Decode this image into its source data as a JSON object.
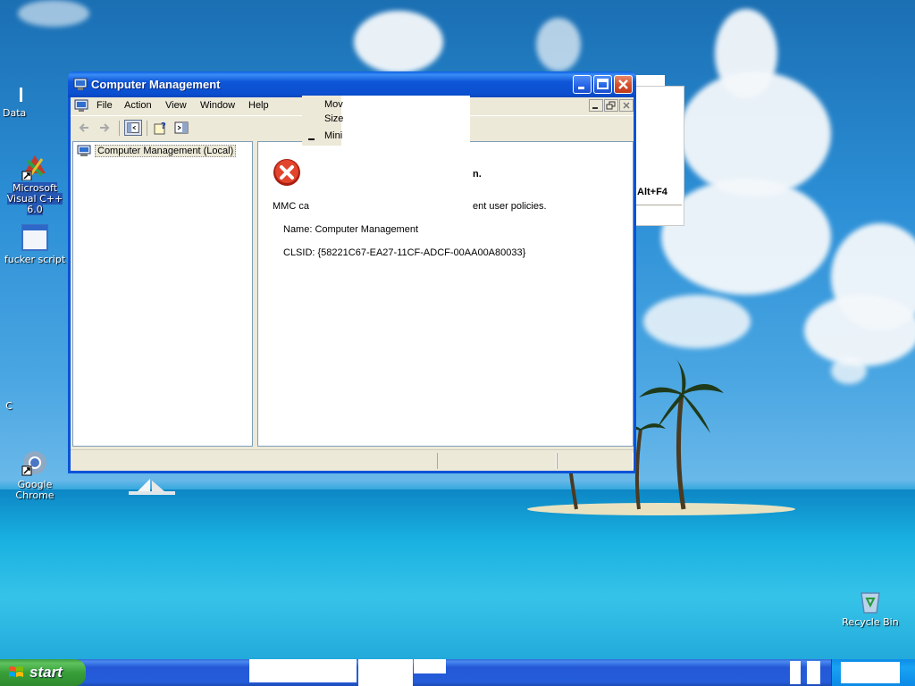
{
  "desktop": {
    "icons": [
      {
        "label": "Data",
        "name": "data-icon"
      },
      {
        "label": "Microsoft Visual C++ 6.0",
        "name": "visual-cpp-icon"
      },
      {
        "label": "fucker script",
        "name": "script-icon"
      },
      {
        "label": "C",
        "name": "c-icon"
      },
      {
        "label": "Google Chrome",
        "name": "chrome-icon"
      },
      {
        "label": "Recycle Bin",
        "name": "recycle-bin-icon"
      }
    ]
  },
  "ghost_menu": {
    "shortcut": "Alt+F4"
  },
  "window": {
    "title": "Computer Management",
    "menu": [
      "File",
      "Action",
      "View",
      "Window",
      "Help"
    ],
    "tree": {
      "root": "Computer Management (Local)"
    },
    "error": {
      "title_fragment": "n.",
      "line1_left": "MMC ca",
      "line1_right": "ent user policies.",
      "name_line": "Name: Computer Management",
      "clsid_line": "CLSID: {58221C67-EA27-11CF-ADCF-00AA00A80033}"
    },
    "system_menu": {
      "items": [
        "Mov",
        "Size",
        "Mini"
      ]
    }
  },
  "taskbar": {
    "start_label": "start"
  },
  "colors": {
    "titlebar": "#0a4fcf",
    "close_button": "#d6512e",
    "start_button": "#38a038",
    "taskbar": "#245dd9"
  }
}
